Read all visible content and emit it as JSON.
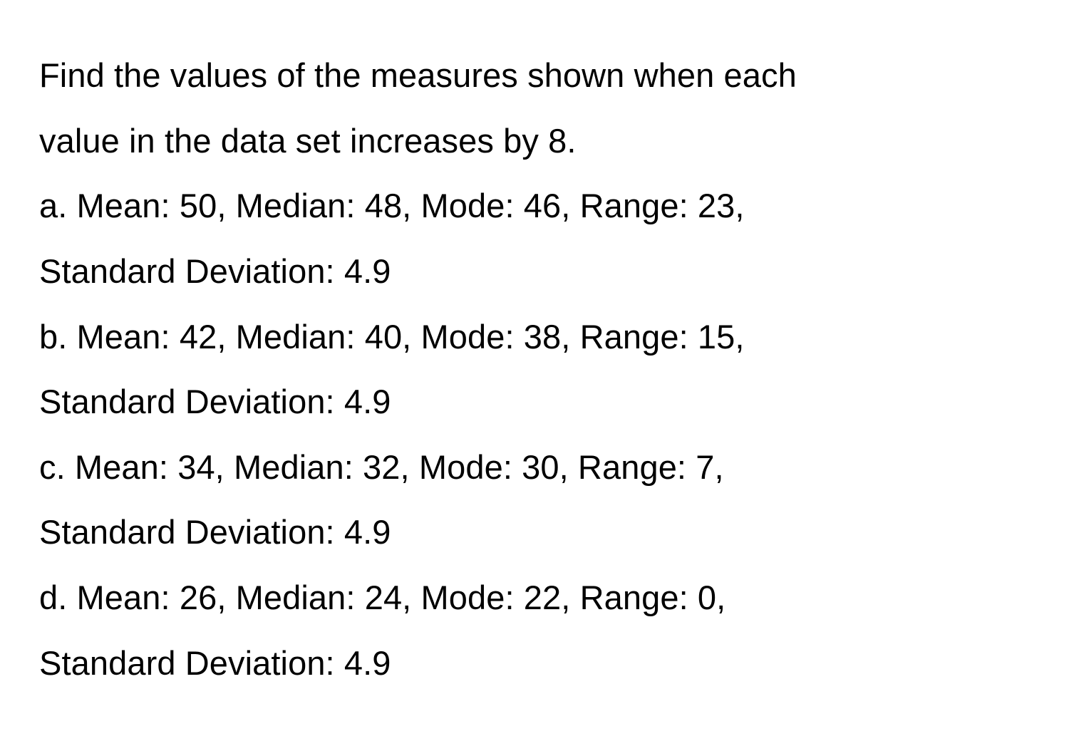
{
  "question": {
    "line1": "Find the values of the measures shown when each",
    "line2": "value in the data set increases by 8."
  },
  "options": {
    "a": {
      "line1": "a. Mean: 50, Median: 48, Mode: 46, Range: 23,",
      "line2": "Standard Deviation: 4.9"
    },
    "b": {
      "line1": "b. Mean: 42, Median: 40, Mode: 38, Range: 15,",
      "line2": "Standard Deviation: 4.9"
    },
    "c": {
      "line1": "c. Mean: 34, Median: 32, Mode: 30, Range: 7,",
      "line2": "Standard Deviation: 4.9"
    },
    "d": {
      "line1": "d. Mean: 26, Median: 24, Mode: 22, Range: 0,",
      "line2": "Standard Deviation: 4.9"
    }
  }
}
